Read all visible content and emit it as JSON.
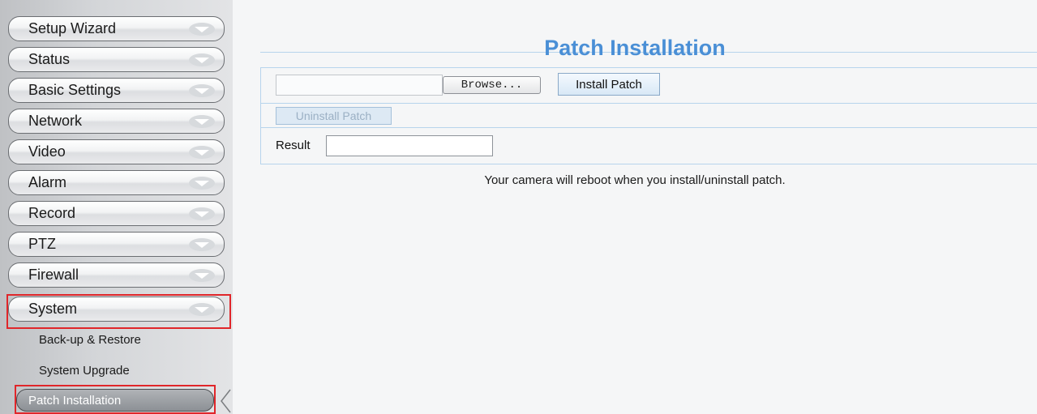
{
  "sidebar": {
    "menu": [
      {
        "label": "Setup Wizard"
      },
      {
        "label": "Status"
      },
      {
        "label": "Basic Settings"
      },
      {
        "label": "Network"
      },
      {
        "label": "Video"
      },
      {
        "label": "Alarm"
      },
      {
        "label": "Record"
      },
      {
        "label": "PTZ"
      },
      {
        "label": "Firewall"
      },
      {
        "label": "System"
      }
    ],
    "submenu": [
      {
        "label": "Back-up & Restore"
      },
      {
        "label": "System Upgrade"
      },
      {
        "label": "Patch Installation"
      }
    ]
  },
  "main": {
    "title": "Patch Installation",
    "file_path_value": "",
    "browse_label": "Browse...",
    "install_label": "Install Patch",
    "uninstall_label": "Uninstall Patch",
    "result_label": "Result",
    "result_value": "",
    "note": "Your camera will reboot when you install/uninstall patch."
  },
  "colors": {
    "title": "#4a8fd6",
    "highlight": "#e0262a",
    "panel_border": "#b7d4ec"
  }
}
